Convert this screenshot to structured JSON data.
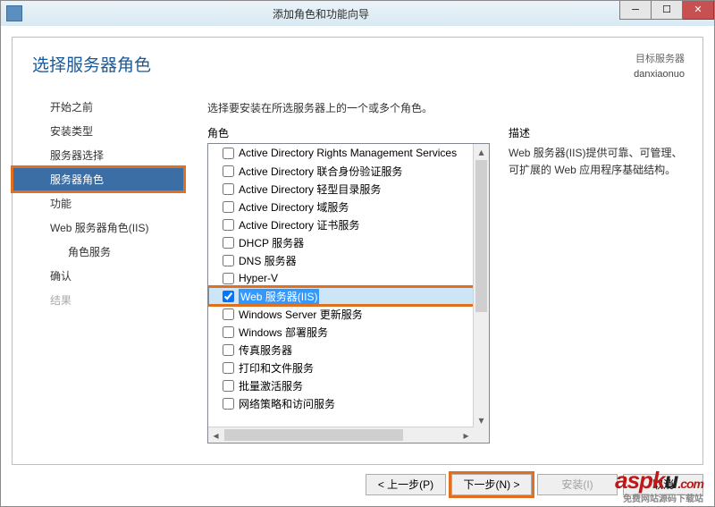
{
  "window": {
    "title": "添加角色和功能向导"
  },
  "header": {
    "heading": "选择服务器角色",
    "target_label": "目标服务器",
    "target_server": "danxiaonuo"
  },
  "nav": {
    "items": [
      {
        "label": "开始之前",
        "selected": false,
        "disabled": false,
        "indent": false
      },
      {
        "label": "安装类型",
        "selected": false,
        "disabled": false,
        "indent": false
      },
      {
        "label": "服务器选择",
        "selected": false,
        "disabled": false,
        "indent": false
      },
      {
        "label": "服务器角色",
        "selected": true,
        "disabled": false,
        "indent": false,
        "highlight": true
      },
      {
        "label": "功能",
        "selected": false,
        "disabled": false,
        "indent": false
      },
      {
        "label": "Web 服务器角色(IIS)",
        "selected": false,
        "disabled": false,
        "indent": false
      },
      {
        "label": "角色服务",
        "selected": false,
        "disabled": false,
        "indent": true
      },
      {
        "label": "确认",
        "selected": false,
        "disabled": false,
        "indent": false
      },
      {
        "label": "结果",
        "selected": false,
        "disabled": true,
        "indent": false
      }
    ]
  },
  "main": {
    "instruction": "选择要安装在所选服务器上的一个或多个角色。",
    "roles_label": "角色",
    "desc_label": "描述",
    "desc_text": "Web 服务器(IIS)提供可靠、可管理、可扩展的 Web 应用程序基础结构。",
    "roles": [
      {
        "label": "Active Directory Rights Management Services",
        "checked": false
      },
      {
        "label": "Active Directory 联合身份验证服务",
        "checked": false
      },
      {
        "label": "Active Directory 轻型目录服务",
        "checked": false
      },
      {
        "label": "Active Directory 域服务",
        "checked": false
      },
      {
        "label": "Active Directory 证书服务",
        "checked": false
      },
      {
        "label": "DHCP 服务器",
        "checked": false
      },
      {
        "label": "DNS 服务器",
        "checked": false
      },
      {
        "label": "Hyper-V",
        "checked": false
      },
      {
        "label": "Web 服务器(IIS)",
        "checked": true,
        "selected": true,
        "highlight": true
      },
      {
        "label": "Windows Server 更新服务",
        "checked": false
      },
      {
        "label": "Windows 部署服务",
        "checked": false
      },
      {
        "label": "传真服务器",
        "checked": false
      },
      {
        "label": "打印和文件服务",
        "checked": false
      },
      {
        "label": "批量激活服务",
        "checked": false
      },
      {
        "label": "网络策略和访问服务",
        "checked": false
      }
    ]
  },
  "footer": {
    "prev": "< 上一步(P)",
    "next": "下一步(N) >",
    "install": "安装(I)",
    "cancel": "取消",
    "next_highlight": true
  },
  "watermark": {
    "text_a": "asp",
    "text_k": "k",
    "text_u": "u",
    "text_com": ".com",
    "sub": "免费网站源码下载站"
  }
}
